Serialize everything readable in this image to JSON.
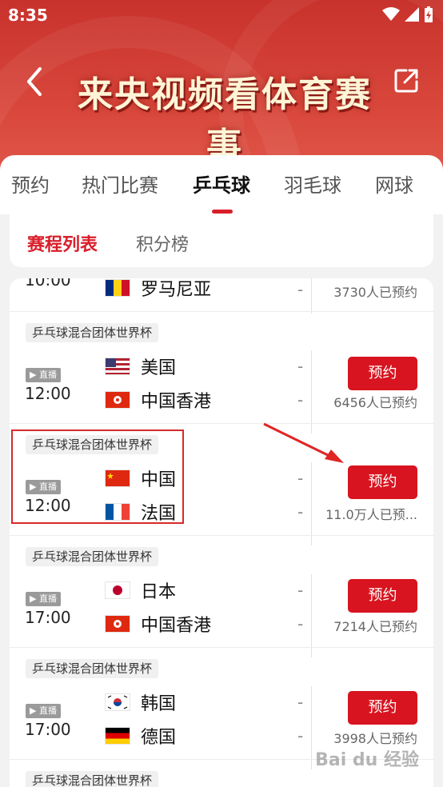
{
  "status_bar": {
    "time": "8:35"
  },
  "header": {
    "title": "来央视频看体育赛事"
  },
  "tabs": [
    {
      "label": "预约"
    },
    {
      "label": "热门比赛"
    },
    {
      "label": "乒乓球"
    },
    {
      "label": "羽毛球"
    },
    {
      "label": "网球"
    }
  ],
  "subtabs": [
    {
      "label": "赛程列表"
    },
    {
      "label": "积分榜"
    }
  ],
  "partial_card": {
    "time": "10:00",
    "team": "罗马尼亚",
    "score": "-",
    "count": "3730人已预约"
  },
  "matches": [
    {
      "tag": "乒乓球混合团体世界杯",
      "live": "▶ 直播",
      "time": "12:00",
      "teams": [
        {
          "name": "美国",
          "score": "-"
        },
        {
          "name": "中国香港",
          "score": "-"
        }
      ],
      "button": "预约",
      "count": "6456人已预约"
    },
    {
      "tag": "乒乓球混合团体世界杯",
      "live": "▶ 直播",
      "time": "12:00",
      "teams": [
        {
          "name": "中国",
          "score": "-"
        },
        {
          "name": "法国",
          "score": "-"
        }
      ],
      "button": "预约",
      "count": "11.0万人已预..."
    },
    {
      "tag": "乒乓球混合团体世界杯",
      "live": "▶ 直播",
      "time": "17:00",
      "teams": [
        {
          "name": "日本",
          "score": "-"
        },
        {
          "name": "中国香港",
          "score": "-"
        }
      ],
      "button": "预约",
      "count": "7214人已预约"
    },
    {
      "tag": "乒乓球混合团体世界杯",
      "live": "▶ 直播",
      "time": "17:00",
      "teams": [
        {
          "name": "韩国",
          "score": "-"
        },
        {
          "name": "德国",
          "score": "-"
        }
      ],
      "button": "预约",
      "count": "3998人已预约"
    }
  ],
  "last_tag": "乒乓球混合团体世界杯",
  "colors": {
    "accent": "#d7141f",
    "header_red": "#c8322c"
  }
}
